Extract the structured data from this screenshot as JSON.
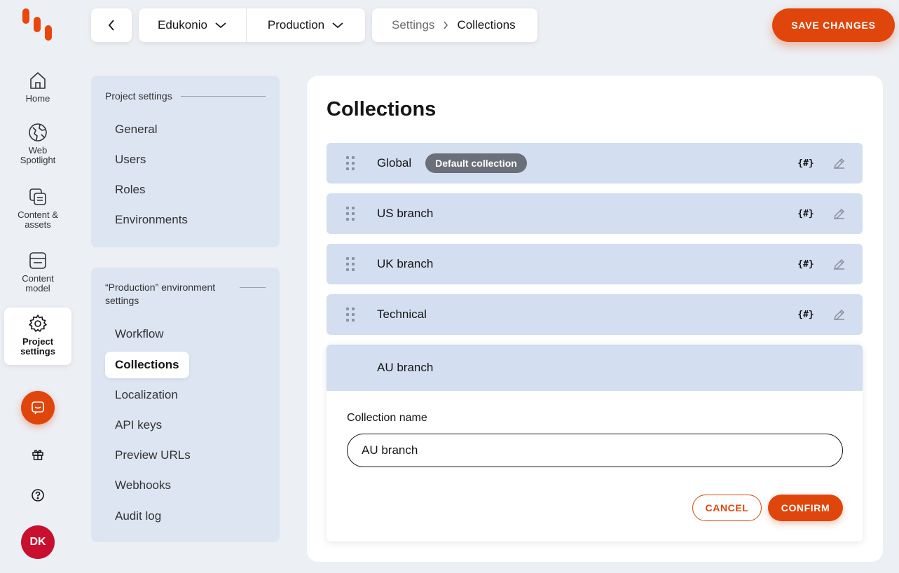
{
  "rail": {
    "items": [
      {
        "label": "Home",
        "icon": "home-icon"
      },
      {
        "label": "Web Spotlight",
        "icon": "globe-icon"
      },
      {
        "label": "Content & assets",
        "icon": "content-icon"
      },
      {
        "label": "Content model",
        "icon": "model-icon"
      },
      {
        "label": "Project settings",
        "icon": "gear-icon"
      }
    ],
    "avatar_initials": "DK"
  },
  "topbar": {
    "project": "Edukonio",
    "environment": "Production",
    "breadcrumb": [
      "Settings",
      "Collections"
    ],
    "save_label": "SAVE CHANGES"
  },
  "nav": {
    "project_heading": "Project settings",
    "project_items": [
      "General",
      "Users",
      "Roles",
      "Environments"
    ],
    "env_heading": "“Production” environment settings",
    "env_items": [
      "Workflow",
      "Collections",
      "Localization",
      "API keys",
      "Preview URLs",
      "Webhooks",
      "Audit log"
    ],
    "active": "Collections"
  },
  "main": {
    "title": "Collections",
    "collections": [
      {
        "name": "Global",
        "badge": "Default collection"
      },
      {
        "name": "US branch"
      },
      {
        "name": "UK branch"
      },
      {
        "name": "Technical"
      }
    ],
    "codename_symbol": "{#}",
    "editing": {
      "name": "AU branch",
      "field_label": "Collection name",
      "field_value": "AU branch",
      "cancel_label": "CANCEL",
      "confirm_label": "CONFIRM"
    }
  },
  "colors": {
    "accent": "#e0450b",
    "row_bg": "#d3def0",
    "nav_bg": "#dde5f2",
    "page_bg": "#eceff4"
  }
}
